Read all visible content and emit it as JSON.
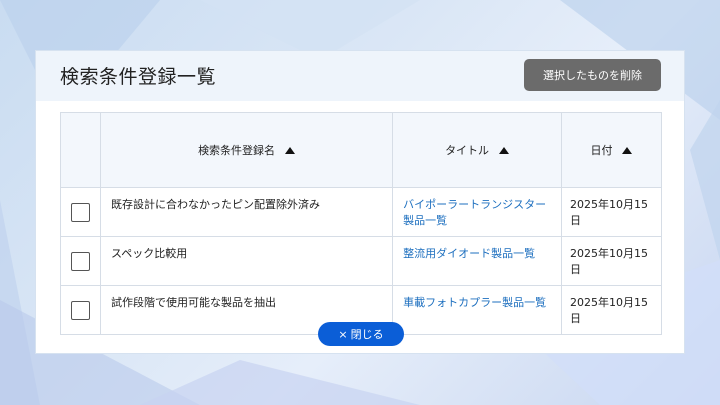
{
  "dialog": {
    "title": "検索条件登録一覧",
    "delete_label": "選択したものを削除",
    "close_icon": "×",
    "close_label": "閉じる"
  },
  "table": {
    "headers": [
      "検索条件登録名",
      "タイトル",
      "日付"
    ],
    "rows": [
      {
        "name": "既存設計に合わなかったピン配置除外済み",
        "title": "バイポーラートランジスター製品一覧",
        "date": "2025年10月15日",
        "checked": false
      },
      {
        "name": "スペック比較用",
        "title": "整流用ダイオード製品一覧",
        "date": "2025年10月15日",
        "checked": false
      },
      {
        "name": "試作段階で使用可能な製品を抽出",
        "title": "車載フォトカプラー製品一覧",
        "date": "2025年10月15日",
        "checked": false
      }
    ]
  },
  "colors": {
    "delete_button": "#6b6b6b",
    "close_button": "#0b5ed7",
    "link": "#1d6fbf",
    "header_bg": "#eef4fb"
  }
}
